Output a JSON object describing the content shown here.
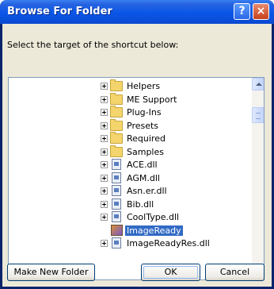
{
  "window": {
    "title": "Browse For Folder",
    "prompt": "Select the target of the shortcut below:"
  },
  "tree": {
    "items": [
      {
        "label": "Helpers",
        "type": "folder",
        "expandable": true,
        "selected": false
      },
      {
        "label": "ME Support",
        "type": "folder",
        "expandable": true,
        "selected": false
      },
      {
        "label": "Plug-Ins",
        "type": "folder",
        "expandable": true,
        "selected": false
      },
      {
        "label": "Presets",
        "type": "folder",
        "expandable": true,
        "selected": false
      },
      {
        "label": "Required",
        "type": "folder",
        "expandable": true,
        "selected": false
      },
      {
        "label": "Samples",
        "type": "folder",
        "expandable": true,
        "selected": false
      },
      {
        "label": "ACE.dll",
        "type": "file",
        "expandable": true,
        "selected": false
      },
      {
        "label": "AGM.dll",
        "type": "file",
        "expandable": true,
        "selected": false
      },
      {
        "label": "Asn.er.dll",
        "type": "file",
        "expandable": true,
        "selected": false
      },
      {
        "label": "Bib.dll",
        "type": "file",
        "expandable": true,
        "selected": false
      },
      {
        "label": "CoolType.dll",
        "type": "file",
        "expandable": true,
        "selected": false
      },
      {
        "label": "ImageReady",
        "type": "app",
        "expandable": false,
        "selected": true
      },
      {
        "label": "ImageReadyRes.dll",
        "type": "file",
        "expandable": true,
        "selected": false
      }
    ]
  },
  "buttons": {
    "make_new_folder": "Make New Folder",
    "ok": "OK",
    "cancel": "Cancel"
  },
  "titlebar_buttons": {
    "help": "?",
    "close": "×"
  },
  "colors": {
    "title_bar": "#0a56e8",
    "selection": "#316ac5",
    "dialog_face": "#ece9d8"
  }
}
